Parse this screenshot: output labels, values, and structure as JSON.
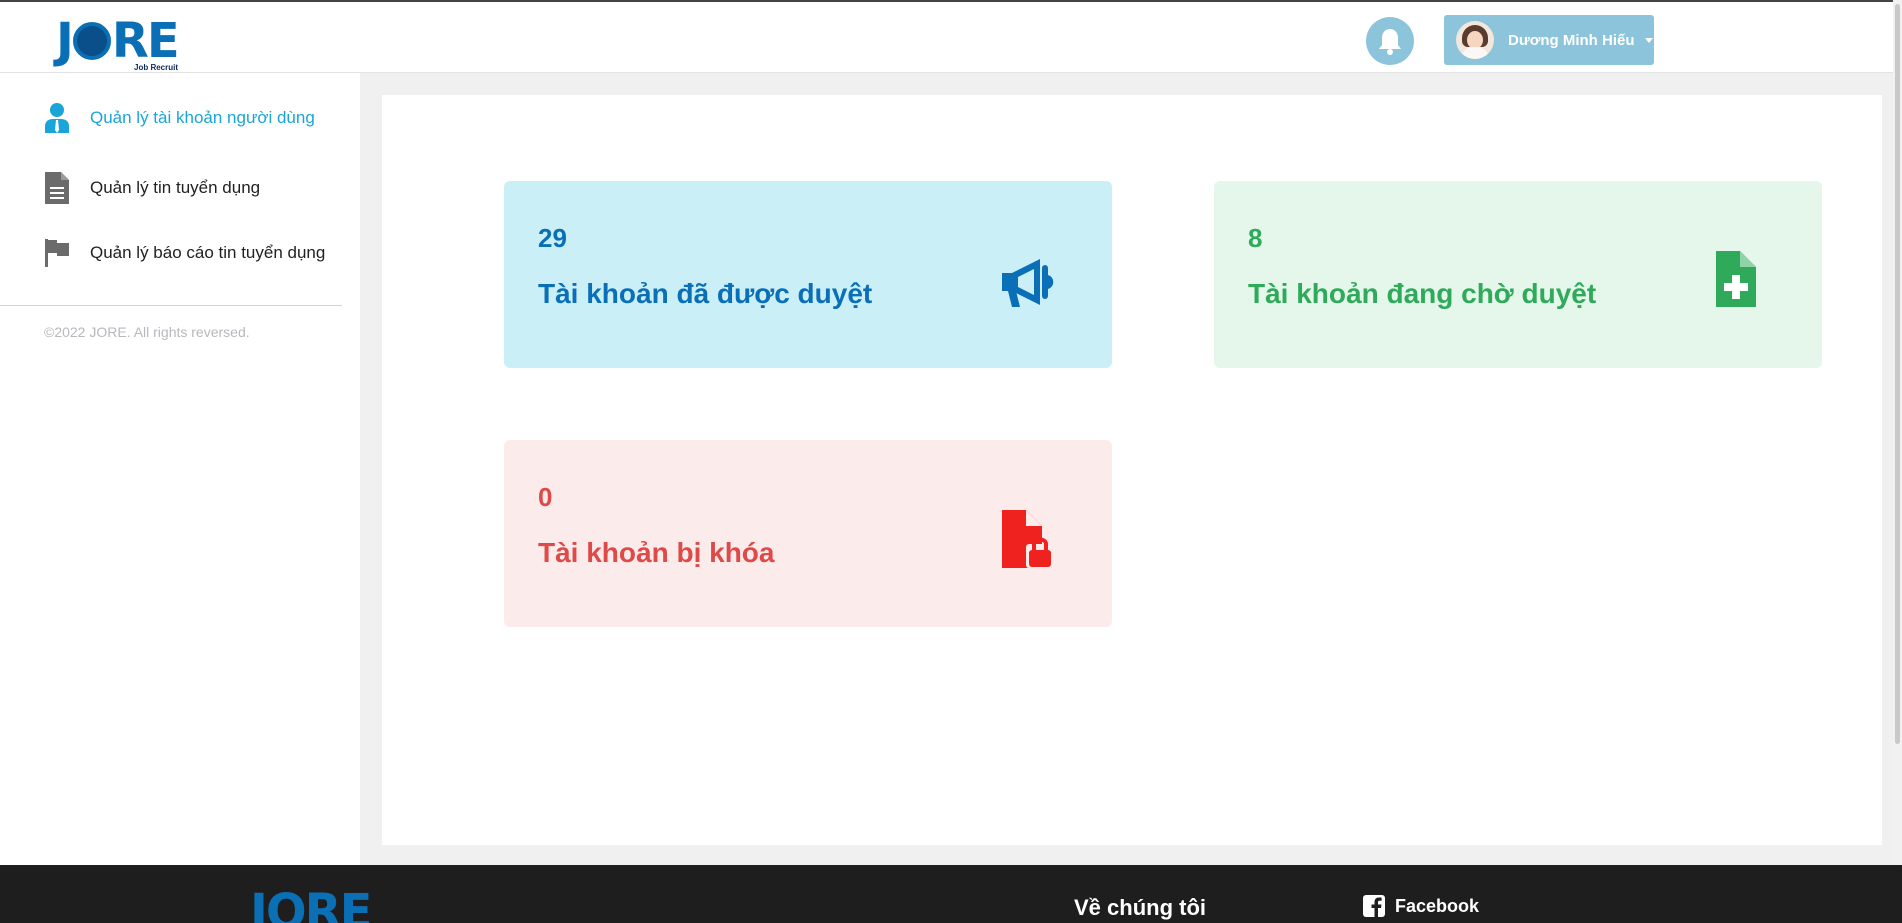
{
  "header": {
    "logo_text": "JORE",
    "logo_subtitle": "Job Recruit",
    "notification_icon": "bell-icon",
    "user": {
      "name": "Dương Minh Hiếu"
    }
  },
  "sidebar": {
    "items": [
      {
        "label": "Quản lý tài khoản người dùng",
        "icon": "user-icon",
        "active": true
      },
      {
        "label": "Quản lý tin tuyển dụng",
        "icon": "document-icon",
        "active": false
      },
      {
        "label": "Quản lý báo cáo tin tuyển dụng",
        "icon": "flag-icon",
        "active": false
      }
    ],
    "copyright": "©2022 JORE. All rights reversed."
  },
  "cards": [
    {
      "count": "29",
      "label": "Tài khoản đã được duyệt",
      "icon": "megaphone-icon",
      "color": "#0b6fb8",
      "bg": "#cbeff6"
    },
    {
      "count": "8",
      "label": "Tài khoản đang chờ duyệt",
      "icon": "file-plus-icon",
      "color": "#2eaa5a",
      "bg": "#e5f6ea"
    },
    {
      "count": "0",
      "label": "Tài khoản bị khóa",
      "icon": "file-lock-icon",
      "color": "#df4a48",
      "bg": "#fcebeb"
    }
  ],
  "footer": {
    "logo_text": "JORE",
    "about_heading": "Về chúng tôi",
    "facebook_label": "Facebook"
  }
}
